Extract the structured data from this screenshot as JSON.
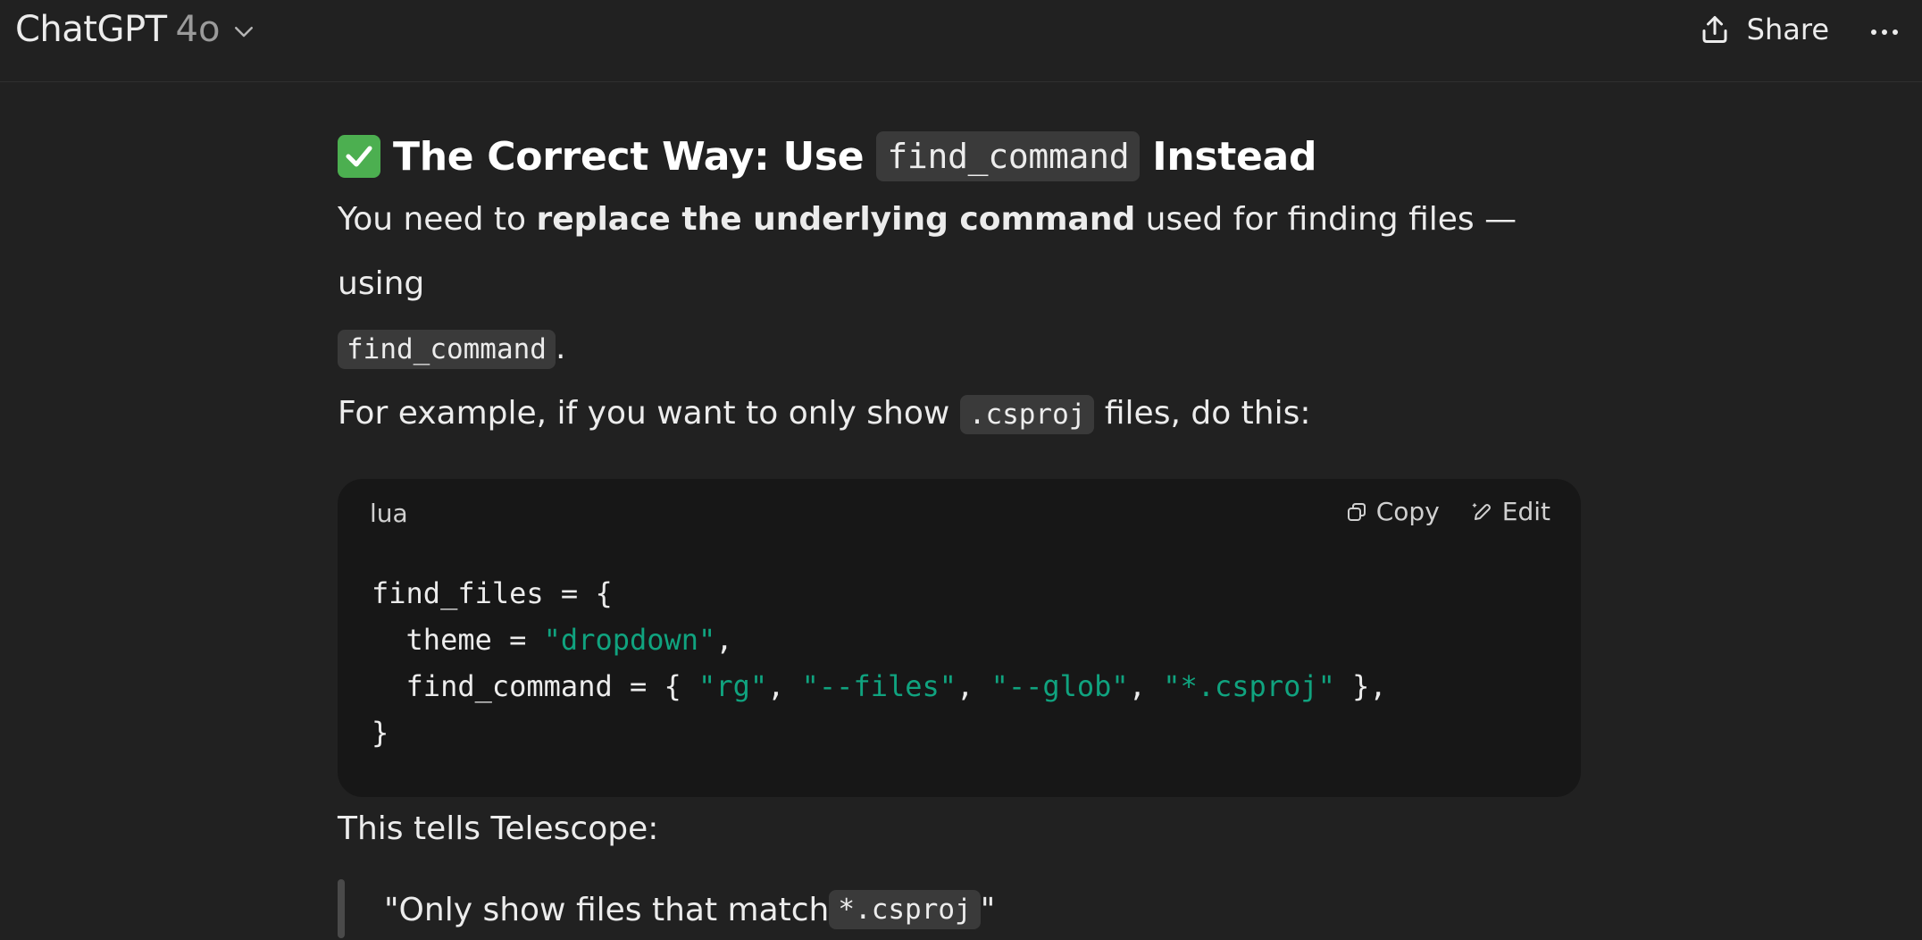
{
  "header": {
    "app_name": "ChatGPT",
    "model": "4o",
    "share_label": "Share"
  },
  "message": {
    "heading": {
      "prefix": "The Correct Way: Use",
      "code": "find_command",
      "suffix": "Instead"
    },
    "para1": {
      "a": "You need to ",
      "bold": "replace the underlying command",
      "b": " used for finding files — using",
      "code": "find_command",
      "c": "."
    },
    "para2": {
      "a": "For example, if you want to only show ",
      "code": ".csproj",
      "b": " files, do this:"
    },
    "code_block": {
      "language": "lua",
      "copy_label": "Copy",
      "edit_label": "Edit",
      "lines": {
        "l1": "find_files = {",
        "l2_a": "  theme = ",
        "l2_s": "\"dropdown\"",
        "l2_b": ",",
        "l3_a": "  find_command = { ",
        "l3_s1": "\"rg\"",
        "l3_c1": ", ",
        "l3_s2": "\"--files\"",
        "l3_c2": ", ",
        "l3_s3": "\"--glob\"",
        "l3_c3": ", ",
        "l3_s4": "\"*.csproj\"",
        "l3_b": " },",
        "l4": "}"
      }
    },
    "para3": "This tells Telescope:",
    "quote": {
      "a": "\"Only show files that match ",
      "code": "*.csproj",
      "b": "\""
    }
  },
  "colors": {
    "background": "#212121",
    "code_bg": "#171717",
    "string": "#10a37f",
    "inline_code_bg": "#3a3a3a"
  },
  "icons": {
    "model_dropdown": "chevron-down-icon",
    "share": "upload-icon",
    "more": "ellipsis-icon",
    "heading": "check-mark-icon",
    "copy": "copy-icon",
    "edit": "pencil-icon"
  }
}
